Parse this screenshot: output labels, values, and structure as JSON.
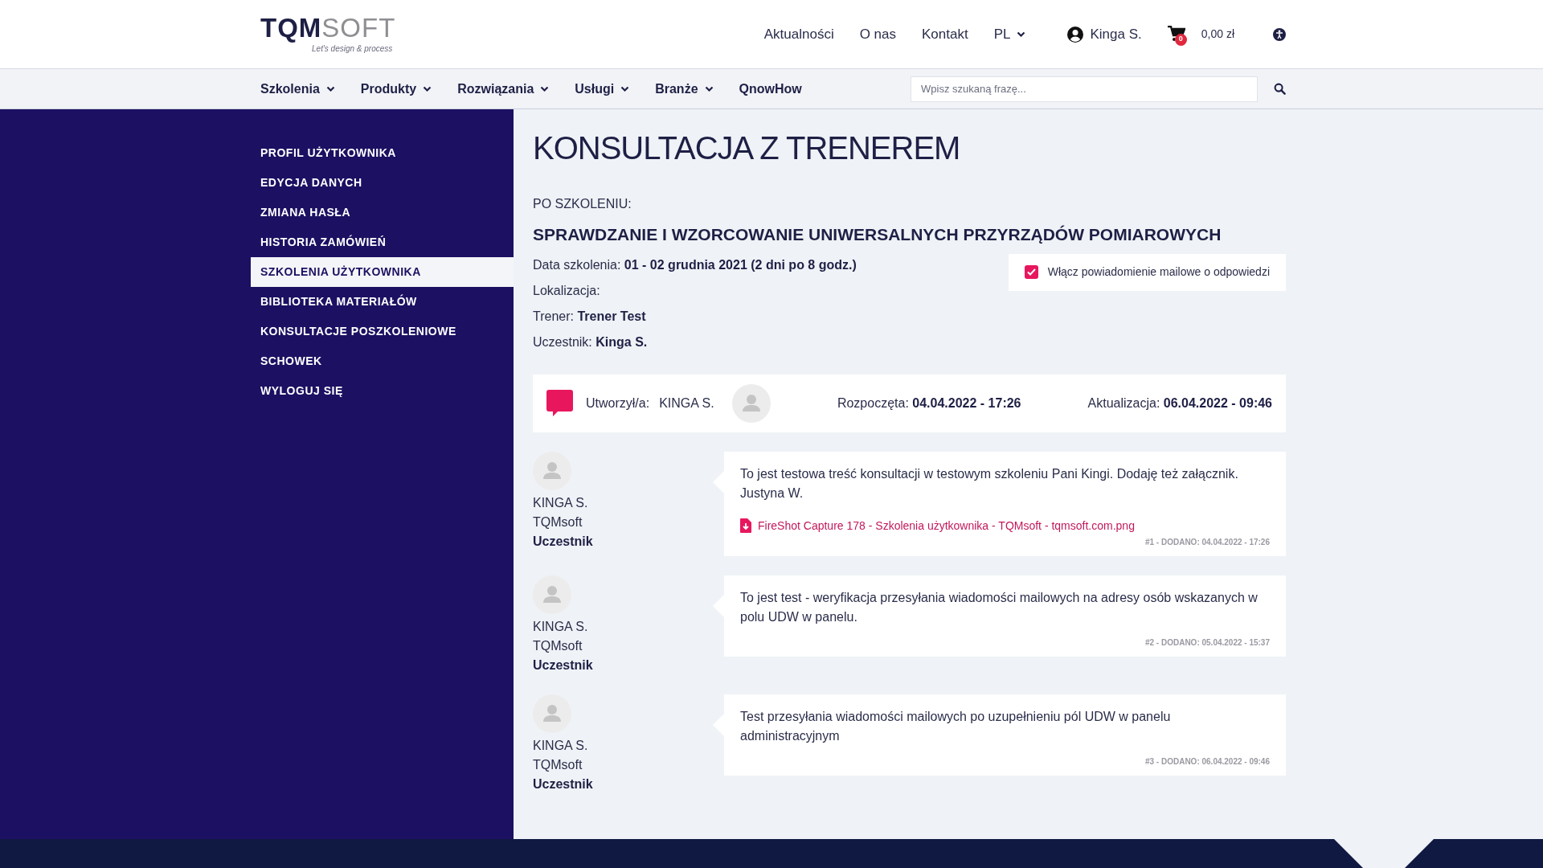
{
  "header": {
    "logo": {
      "main": "TQM",
      "accent": "SOFT",
      "tagline": "Let's design & process"
    },
    "top_links": [
      "Aktualności",
      "O nas",
      "Kontakt"
    ],
    "language": "PL",
    "user": "Kinga S.",
    "cart": {
      "count": "0",
      "total": "0,00 zł"
    }
  },
  "main_nav": [
    {
      "label": "Szkolenia",
      "dropdown": true
    },
    {
      "label": "Produkty",
      "dropdown": true
    },
    {
      "label": "Rozwiązania",
      "dropdown": true
    },
    {
      "label": "Usługi",
      "dropdown": true
    },
    {
      "label": "Branże",
      "dropdown": true
    },
    {
      "label": "QnowHow",
      "dropdown": false
    }
  ],
  "search": {
    "placeholder": "Wpisz szukaną frazę..."
  },
  "sidebar": {
    "items": [
      {
        "label": "PROFIL UŻYTKOWNIKA",
        "selected": false
      },
      {
        "label": "EDYCJA DANYCH",
        "selected": false
      },
      {
        "label": "ZMIANA HASŁA",
        "selected": false
      },
      {
        "label": "HISTORIA ZAMÓWIEŃ",
        "selected": false
      },
      {
        "label": "SZKOLENIA UŻYTKOWNIKA",
        "selected": true
      },
      {
        "label": "BIBLIOTEKA MATERIAŁÓW",
        "selected": false
      },
      {
        "label": "KONSULTACJE POSZKOLENIOWE",
        "selected": false
      },
      {
        "label": "SCHOWEK",
        "selected": false
      },
      {
        "label": "WYLOGUJ SIĘ",
        "selected": false
      }
    ]
  },
  "page": {
    "title": "KONSULTACJA Z TRENEREM",
    "course_label": "PO SZKOLENIU:",
    "course_name": "SPRAWDZANIE I WZORCOWANIE UNIWERSALNYCH PRZYRZĄDÓW POMIAROWYCH",
    "details": [
      {
        "label": "Data szkolenia:",
        "value": "01 - 02 grudnia 2021 (2 dni po 8 godz.)"
      },
      {
        "label": "Lokalizacja:"
      },
      {
        "label": "Trener:",
        "value": "Trener Test"
      },
      {
        "label": "Uczestnik:",
        "value": "Kinga S."
      }
    ],
    "notify": {
      "label": "Włącz powiadomienie mailowe o odpowiedzi",
      "checked": true
    }
  },
  "consultation": {
    "created_label": "Utworzył/a:",
    "created_by": "KINGA S.",
    "started_label": "Rozpoczęta:",
    "started": "04.04.2022 - 17:26",
    "updated_label": "Aktualizacja:",
    "updated": "06.04.2022 - 09:46"
  },
  "messages": [
    {
      "author": "KINGA S.",
      "company": "TQMsoft",
      "role": "Uczestnik",
      "text": "To jest testowa treść konsultacji w testowym szkoleniu Pani Kingi. Dodaję też załącznik. Justyna W.",
      "attachment": "FireShot Capture 178 - Szkolenia użytkownika - TQMsoft - tqmsoft.com.png",
      "meta": "#1 - DODANO: 04.04.2022 - 17:26"
    },
    {
      "author": "KINGA S.",
      "company": "TQMsoft",
      "role": "Uczestnik",
      "text": "To jest test - weryfikacja przesyłania wiadomości mailowych na adresy osób wskazanych w polu UDW w panelu.",
      "meta": "#2 - DODANO: 05.04.2022 - 15:37"
    },
    {
      "author": "KINGA S.",
      "company": "TQMsoft",
      "role": "Uczestnik",
      "text": "Test przesyłania wiadomości mailowych po uzupełnieniu pól UDW w panelu administracyjnym",
      "meta": "#3 - DODANO: 06.04.2022 - 09:46"
    }
  ]
}
